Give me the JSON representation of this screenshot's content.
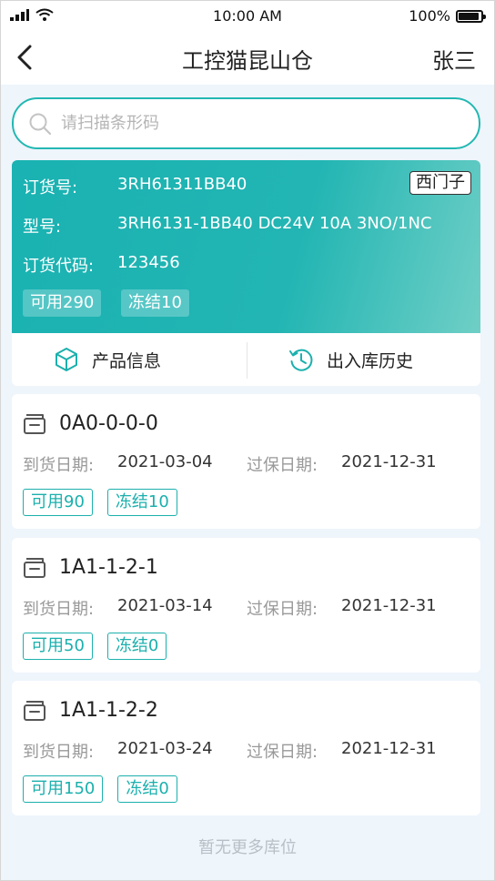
{
  "status_bar": {
    "time": "10:00 AM",
    "battery": "100%"
  },
  "nav": {
    "title": "工控猫昆山仓",
    "user": "张三"
  },
  "search": {
    "placeholder": "请扫描条形码",
    "value": ""
  },
  "product": {
    "order_no_label": "订货号:",
    "order_no": "3RH61311BB40",
    "brand": "西门子",
    "model_label": "型号:",
    "model": "3RH6131-1BB40 DC24V 10A 3NO/1NC",
    "order_code_label": "订货代码:",
    "order_code": "123456",
    "available": "可用290",
    "frozen": "冻结10"
  },
  "actions": {
    "product_info": "产品信息",
    "history": "出入库历史"
  },
  "locations": [
    {
      "code": "0A0-0-0-0",
      "arrival_label": "到货日期:",
      "arrival": "2021-03-04",
      "warranty_label": "过保日期:",
      "warranty": "2021-12-31",
      "available": "可用90",
      "frozen": "冻结10"
    },
    {
      "code": "1A1-1-2-1",
      "arrival_label": "到货日期:",
      "arrival": "2021-03-14",
      "warranty_label": "过保日期:",
      "warranty": "2021-12-31",
      "available": "可用50",
      "frozen": "冻结0"
    },
    {
      "code": "1A1-1-2-2",
      "arrival_label": "到货日期:",
      "arrival": "2021-03-24",
      "warranty_label": "过保日期:",
      "warranty": "2021-12-31",
      "available": "可用150",
      "frozen": "冻结0"
    }
  ],
  "footer": "暂无更多库位",
  "colors": {
    "accent": "#1bb0ad",
    "background": "#eef5fb"
  },
  "icons": {
    "search": "search-icon",
    "back": "back-arrow-icon",
    "product_info": "cube-icon",
    "history": "history-clock-icon",
    "location": "storage-box-icon"
  }
}
